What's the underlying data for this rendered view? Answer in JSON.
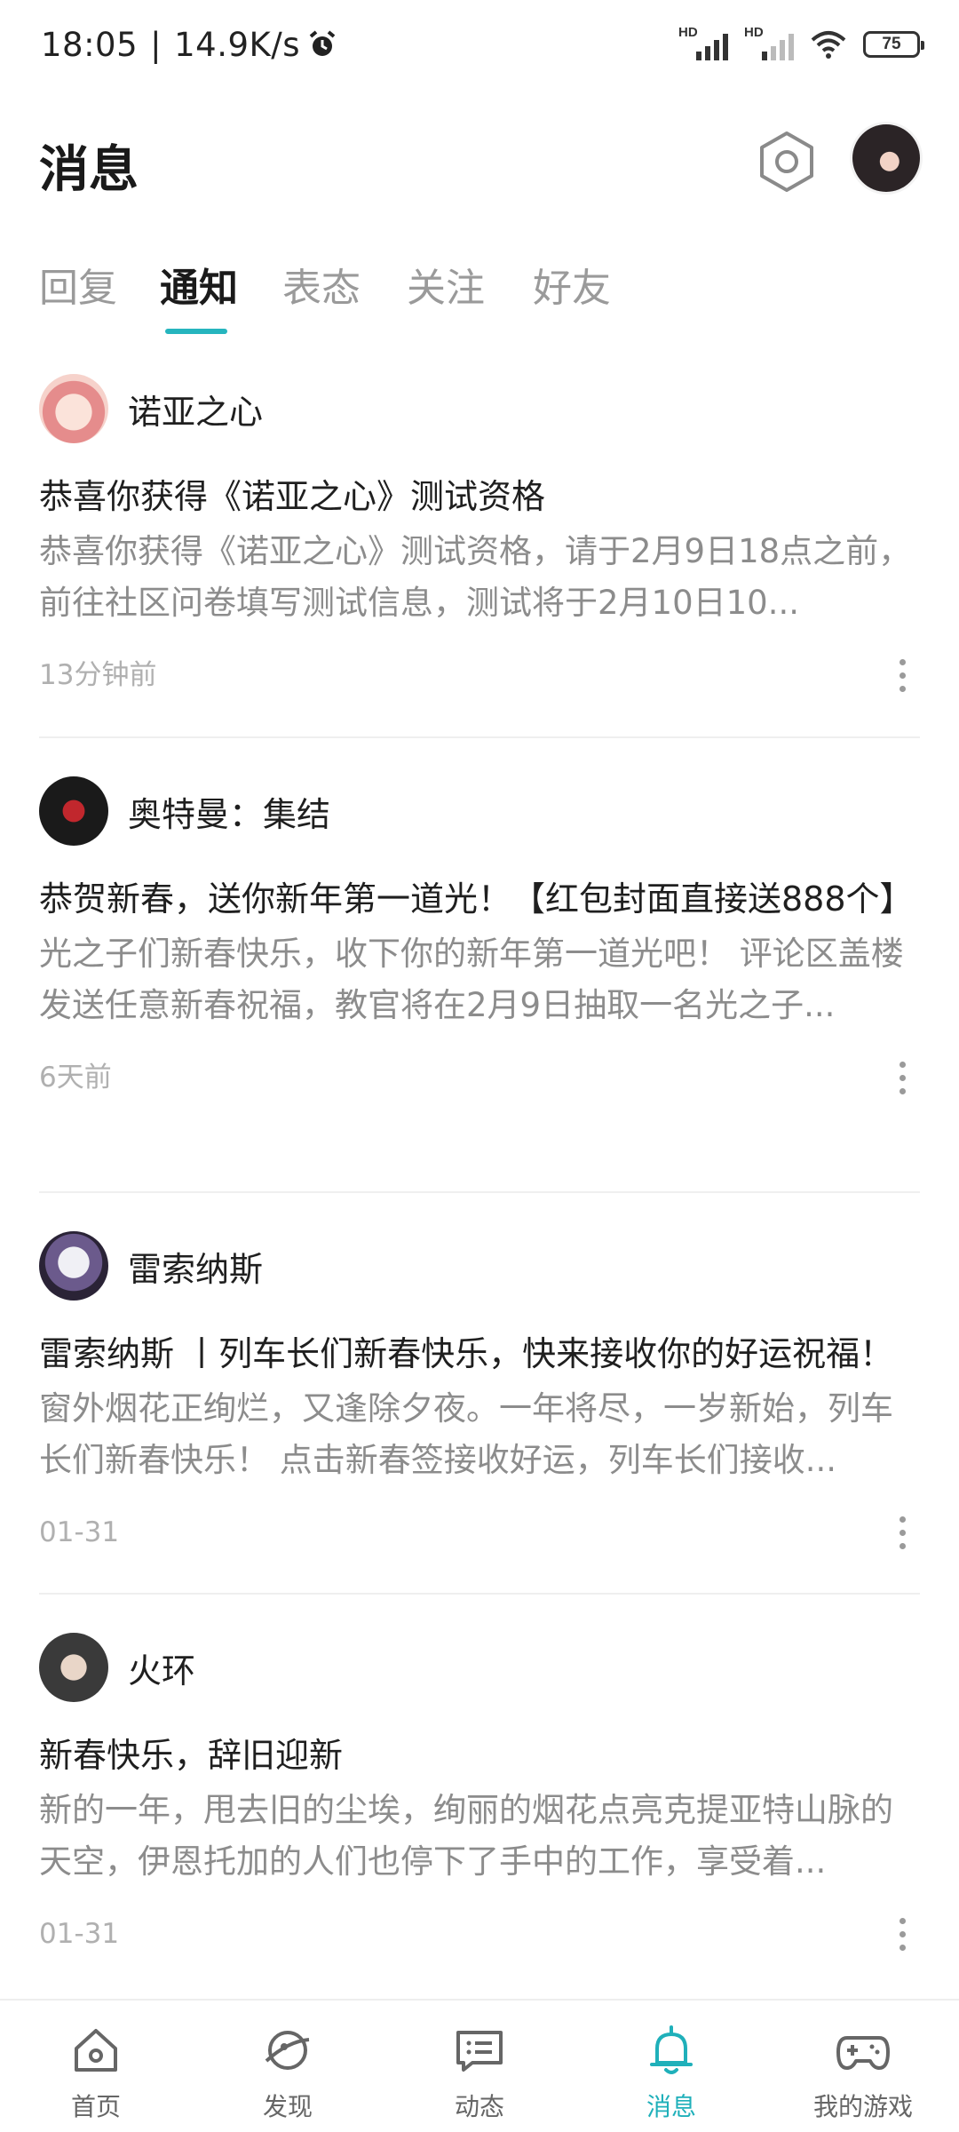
{
  "status_bar": {
    "time": "18:05",
    "separator": "|",
    "speed": "14.9K/s",
    "hd1": "HD",
    "hd2": "HD",
    "battery": "75"
  },
  "header": {
    "title": "消息"
  },
  "tabs": [
    {
      "label": "回复",
      "active": false
    },
    {
      "label": "通知",
      "active": true
    },
    {
      "label": "表态",
      "active": false
    },
    {
      "label": "关注",
      "active": false
    },
    {
      "label": "好友",
      "active": false
    }
  ],
  "notifications": [
    {
      "sender": "诺亚之心",
      "title": "恭喜你获得《诺亚之心》测试资格",
      "body": "恭喜你获得《诺亚之心》测试资格，请于2月9日18点之前，前往社区问卷填写测试信息，测试将于2月10日10...",
      "time": "13分钟前"
    },
    {
      "sender": "奥特曼：集结",
      "title": "恭贺新春，送你新年第一道光！【红包封面直接送888个】",
      "body": "光之子们新春快乐，收下你的新年第一道光吧！ 评论区盖楼发送任意新春祝福，教官将在2月9日抽取一名光之子...",
      "time": "6天前"
    },
    {
      "sender": "雷索纳斯",
      "title": "雷索纳斯 丨列车长们新春快乐，快来接收你的好运祝福！",
      "body": "窗外烟花正绚烂，又逢除夕夜。一年将尽，一岁新始，列车长们新春快乐！ 点击新春签接收好运，列车长们接收...",
      "time": "01-31"
    },
    {
      "sender": "火环",
      "title": "新春快乐，辞旧迎新",
      "body": "新的一年，甩去旧的尘埃，绚丽的烟花点亮克提亚特山脉的天空，伊恩托加的人们也停下了手中的工作，享受着...",
      "time": "01-31"
    }
  ],
  "bottom_nav": [
    {
      "label": "首页",
      "icon": "home-icon"
    },
    {
      "label": "发现",
      "icon": "discover-icon"
    },
    {
      "label": "动态",
      "icon": "feed-icon"
    },
    {
      "label": "消息",
      "icon": "bell-icon",
      "active": true
    },
    {
      "label": "我的游戏",
      "icon": "gamepad-icon"
    }
  ],
  "colors": {
    "accent": "#26b5be",
    "text_primary": "#1f1f1f",
    "text_secondary": "#8c8c8c",
    "text_muted": "#b0b0b0"
  }
}
